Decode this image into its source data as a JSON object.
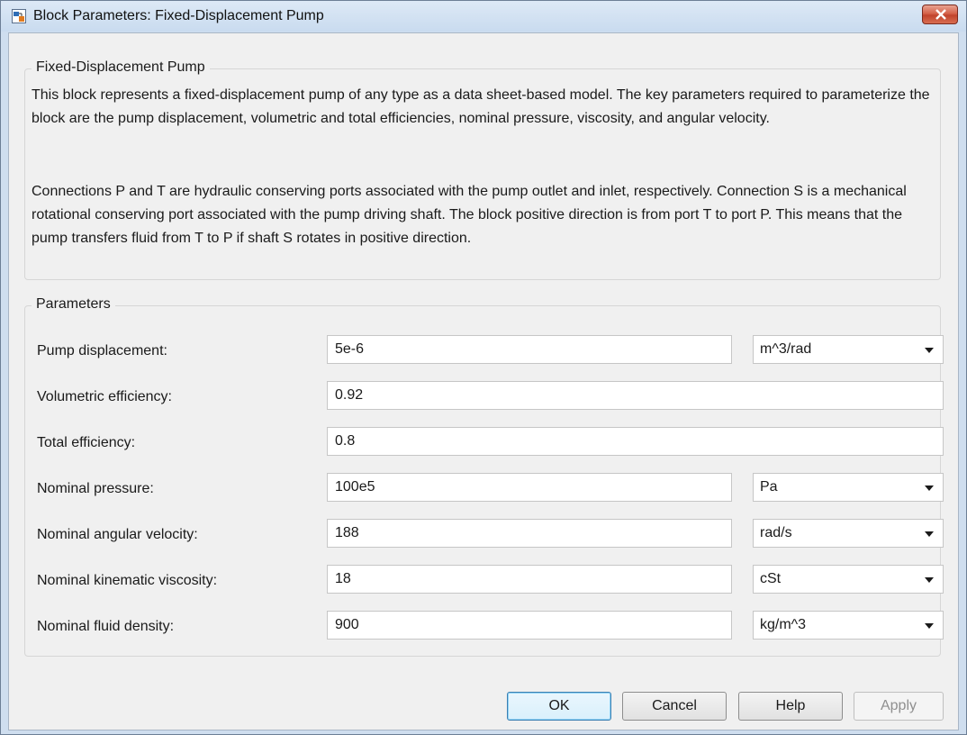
{
  "window": {
    "title": "Block Parameters: Fixed-Displacement Pump",
    "app_icon": "simulink-block-icon",
    "close_icon": "close-icon"
  },
  "description": {
    "legend": "Fixed-Displacement Pump",
    "paragraph1": "This block represents a fixed-displacement pump of any type as a data sheet-based model. The key parameters required to parameterize the block are the pump displacement, volumetric and total efficiencies, nominal pressure, viscosity, and angular velocity.",
    "paragraph2": "Connections P and T are hydraulic conserving ports associated with the pump outlet and inlet, respectively. Connection S is a mechanical rotational conserving port associated with the pump driving shaft. The block positive direction is from port T to port P. This means that the pump transfers fluid from T to P if shaft S rotates in positive direction."
  },
  "parameters": {
    "legend": "Parameters",
    "rows": [
      {
        "label": "Pump displacement:",
        "value": "5e-6",
        "unit": "m^3/rad"
      },
      {
        "label": "Volumetric efficiency:",
        "value": "0.92",
        "unit": null
      },
      {
        "label": "Total efficiency:",
        "value": "0.8",
        "unit": null
      },
      {
        "label": "Nominal pressure:",
        "value": "100e5",
        "unit": "Pa"
      },
      {
        "label": "Nominal angular velocity:",
        "value": "188",
        "unit": "rad/s"
      },
      {
        "label": "Nominal kinematic viscosity:",
        "value": "18",
        "unit": "cSt"
      },
      {
        "label": "Nominal fluid density:",
        "value": "900",
        "unit": "kg/m^3"
      }
    ],
    "dropdown_icon": "chevron-down-icon"
  },
  "buttons": {
    "ok": "OK",
    "cancel": "Cancel",
    "help": "Help",
    "apply": "Apply"
  },
  "colors": {
    "window_frame": "#cfdeef",
    "dialog_bg": "#f0f0f0",
    "close_button": "#c1432c",
    "default_button_border": "#3c7fb1"
  }
}
